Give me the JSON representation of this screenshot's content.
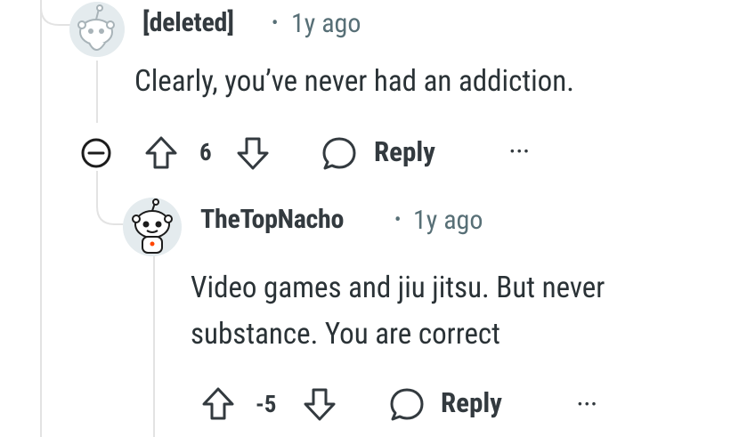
{
  "comment1": {
    "username": "[deleted]",
    "separator": "•",
    "age": "1y ago",
    "body": "Clearly, you’ve never had an addiction.",
    "score": "6",
    "reply_label": "Reply",
    "more_label": "···"
  },
  "comment2": {
    "username": "TheTopNacho",
    "separator": "•",
    "age": "1y ago",
    "body_line1": "Video games and jiu jitsu. But never",
    "body_line2": "substance. You are correct",
    "score": "-5",
    "reply_label": "Reply",
    "more_label": "···"
  }
}
